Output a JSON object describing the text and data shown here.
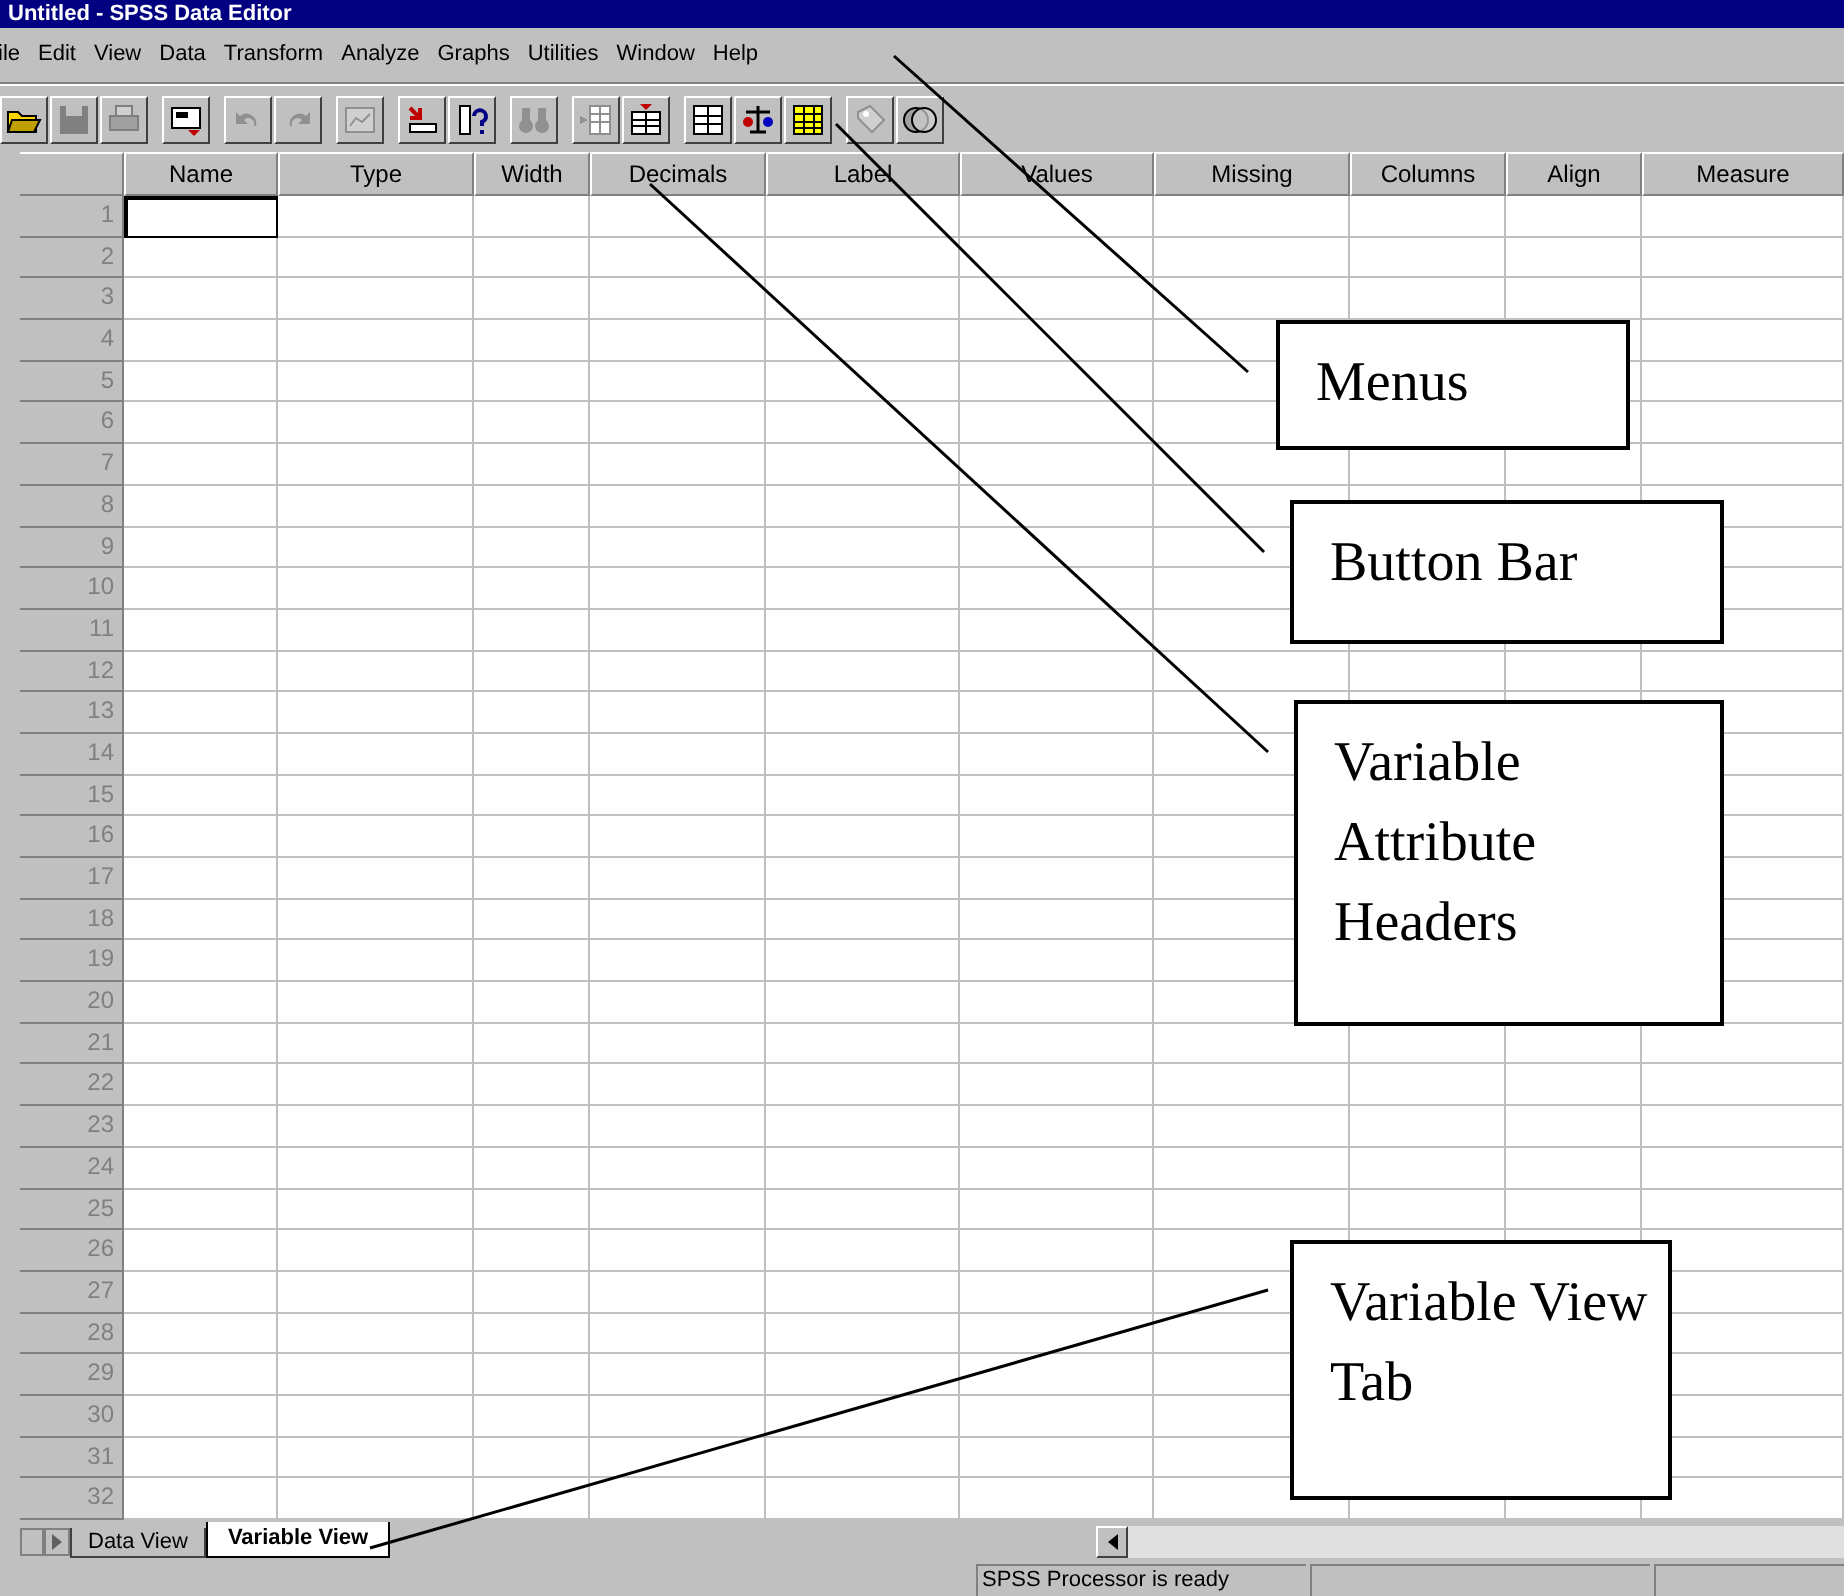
{
  "window": {
    "title": "Untitled - SPSS Data Editor"
  },
  "menus": [
    "ile",
    "Edit",
    "View",
    "Data",
    "Transform",
    "Analyze",
    "Graphs",
    "Utilities",
    "Window",
    "Help"
  ],
  "table": {
    "columns": [
      "Name",
      "Type",
      "Width",
      "Decimals",
      "Label",
      "Values",
      "Missing",
      "Columns",
      "Align",
      "Measure"
    ],
    "rows": [
      {
        "label": "1",
        "selected": true
      },
      {
        "label": "2",
        "selected": false
      },
      {
        "label": "3",
        "selected": false
      },
      {
        "label": "4",
        "selected": false
      },
      {
        "label": "5",
        "selected": false
      },
      {
        "label": "6",
        "selected": false
      },
      {
        "label": "7",
        "selected": false
      },
      {
        "label": "8",
        "selected": false
      },
      {
        "label": "9",
        "selected": false
      },
      {
        "label": "10",
        "selected": false
      },
      {
        "label": "11",
        "selected": false
      },
      {
        "label": "12",
        "selected": false
      },
      {
        "label": "13",
        "selected": false
      },
      {
        "label": "14",
        "selected": false
      },
      {
        "label": "15",
        "selected": false
      },
      {
        "label": "16",
        "selected": false
      },
      {
        "label": "17",
        "selected": false
      },
      {
        "label": "18",
        "selected": false
      },
      {
        "label": "19",
        "selected": false
      },
      {
        "label": "20",
        "selected": false
      },
      {
        "label": "21",
        "selected": false
      },
      {
        "label": "22",
        "selected": false
      },
      {
        "label": "23",
        "selected": false
      },
      {
        "label": "24",
        "selected": false
      },
      {
        "label": "25",
        "selected": false
      },
      {
        "label": "26",
        "selected": false
      },
      {
        "label": "27",
        "selected": false
      },
      {
        "label": "28",
        "selected": false
      },
      {
        "label": "29",
        "selected": false
      },
      {
        "label": "30",
        "selected": false
      },
      {
        "label": "31",
        "selected": false
      },
      {
        "label": "32",
        "selected": false
      }
    ]
  },
  "tabs": [
    {
      "label": "Data View",
      "selected": false
    },
    {
      "label": "Variable View",
      "selected": true
    }
  ],
  "status_bar": {
    "message": "SPSS Processor  is ready"
  },
  "callouts": [
    {
      "text": "Menus"
    },
    {
      "text": "Button Bar"
    },
    {
      "text": "Variable Attribute Headers"
    },
    {
      "text": "Variable View Tab"
    }
  ]
}
